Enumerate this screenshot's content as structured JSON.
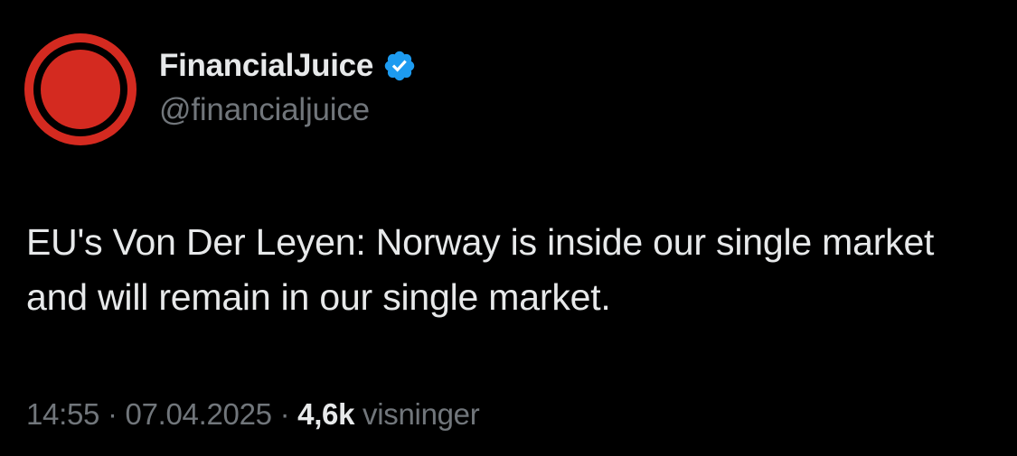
{
  "author": {
    "display_name": "FinancialJuice",
    "handle": "@financialjuice",
    "verified": true,
    "avatar_icon": "red-circle-logo",
    "verified_icon": "verified-badge-icon",
    "verified_color": "#1d9bf0",
    "avatar_color": "#d42a20"
  },
  "tweet": {
    "text": "EU's Von Der Leyen: Norway is inside our single market and will remain in our single market."
  },
  "meta": {
    "time": "14:55",
    "separator": " · ",
    "date": "07.04.2025",
    "views_count": "4,6k",
    "views_label": "visninger"
  }
}
